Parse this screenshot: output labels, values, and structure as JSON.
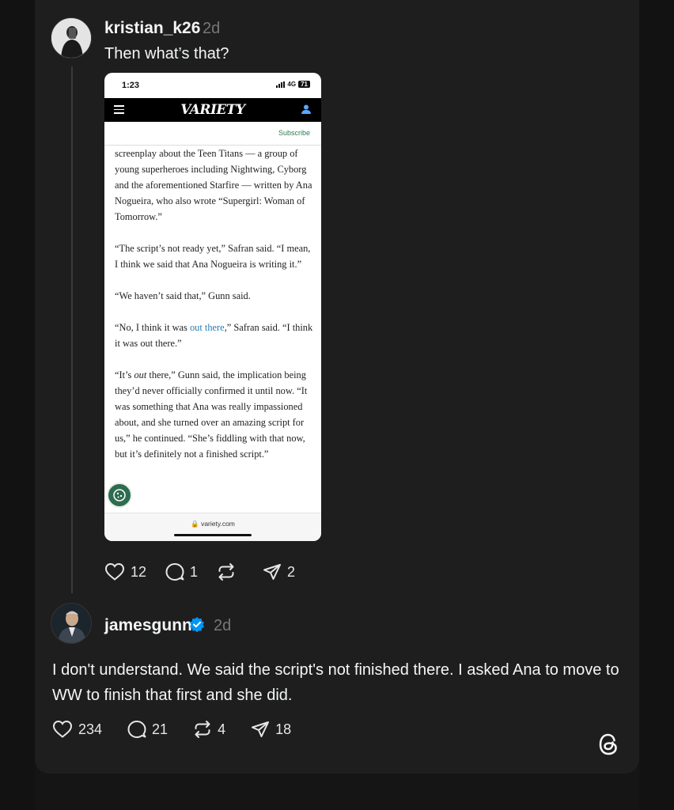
{
  "post1": {
    "username": "kristian_k26",
    "time": "2d",
    "text": "Then what’s that?",
    "screenshot": {
      "clock": "1:23",
      "network": "4G",
      "battery": "71",
      "logo": "VARIETY",
      "subscribe": "Subscribe",
      "paragraphs": [
        "screenplay about the Teen Titans — a group of young superheroes including Nightwing, Cyborg and the aforementioned Starfire — written by Ana Nogueira, who also wrote “Supergirl: Woman of Tomorrow.”",
        "“The script’s not ready yet,” Safran said. “I mean, I think we said that Ana Nogueira is writing it.”",
        "“We haven’t said that,” Gunn said."
      ],
      "p4_before": "“No, I think it was ",
      "p4_link": "out there",
      "p4_after": ",” Safran said. “I think it was out there.”",
      "p5_before": "“It’s ",
      "p5_em": "out",
      "p5_after": " there,” Gunn said, the implication being they’d never officially confirmed it until now. “It was something that Ana was really impassioned about, and she turned over an amazing script for us,” he continued. “She’s fiddling with that now, but it’s definitely not a finished script.”",
      "url": "variety.com"
    },
    "likes": "12",
    "replies": "1",
    "shares": "2"
  },
  "post2": {
    "username": "jamesgunn",
    "time": "2d",
    "text": "I don't understand. We said the script's not finished there. I asked Ana to move to WW to finish that first and she did.",
    "likes": "234",
    "replies": "21",
    "reposts": "4",
    "shares": "18"
  },
  "colors": {
    "background": "#151515",
    "card": "#1e1e1e",
    "verified": "#0095f6",
    "link": "#2a7ab0"
  }
}
